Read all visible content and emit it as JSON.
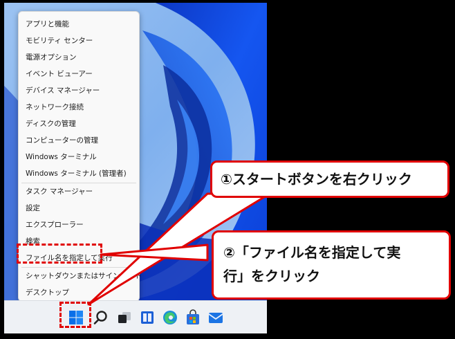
{
  "context_menu": {
    "items": [
      {
        "label": "アプリと機能"
      },
      {
        "label": "モビリティ センター"
      },
      {
        "label": "電源オプション"
      },
      {
        "label": "イベント ビューアー"
      },
      {
        "label": "デバイス マネージャー"
      },
      {
        "label": "ネットワーク接続"
      },
      {
        "label": "ディスクの管理"
      },
      {
        "label": "コンピューターの管理"
      },
      {
        "label": "Windows ターミナル"
      },
      {
        "label": "Windows ターミナル (管理者)"
      },
      {
        "label": "タスク マネージャー"
      },
      {
        "label": "設定"
      },
      {
        "label": "エクスプローラー"
      },
      {
        "label": "検索"
      },
      {
        "label": "ファイル名を指定して実行"
      },
      {
        "label": "シャットダウンまたはサインアウト",
        "chevron": "›"
      },
      {
        "label": "デスクトップ"
      }
    ]
  },
  "taskbar": {
    "icons": [
      "start-icon",
      "search-icon",
      "task-view-icon",
      "widgets-icon",
      "edge-icon",
      "store-icon",
      "mail-icon"
    ]
  },
  "callouts": {
    "step1": "①スタートボタンを右クリック",
    "step2_line1": "②「ファイル名を指定して実",
    "step2_line2": "行」をクリック"
  },
  "colors": {
    "highlight": "#e00000",
    "wallpaper": "#0a3fd6"
  }
}
